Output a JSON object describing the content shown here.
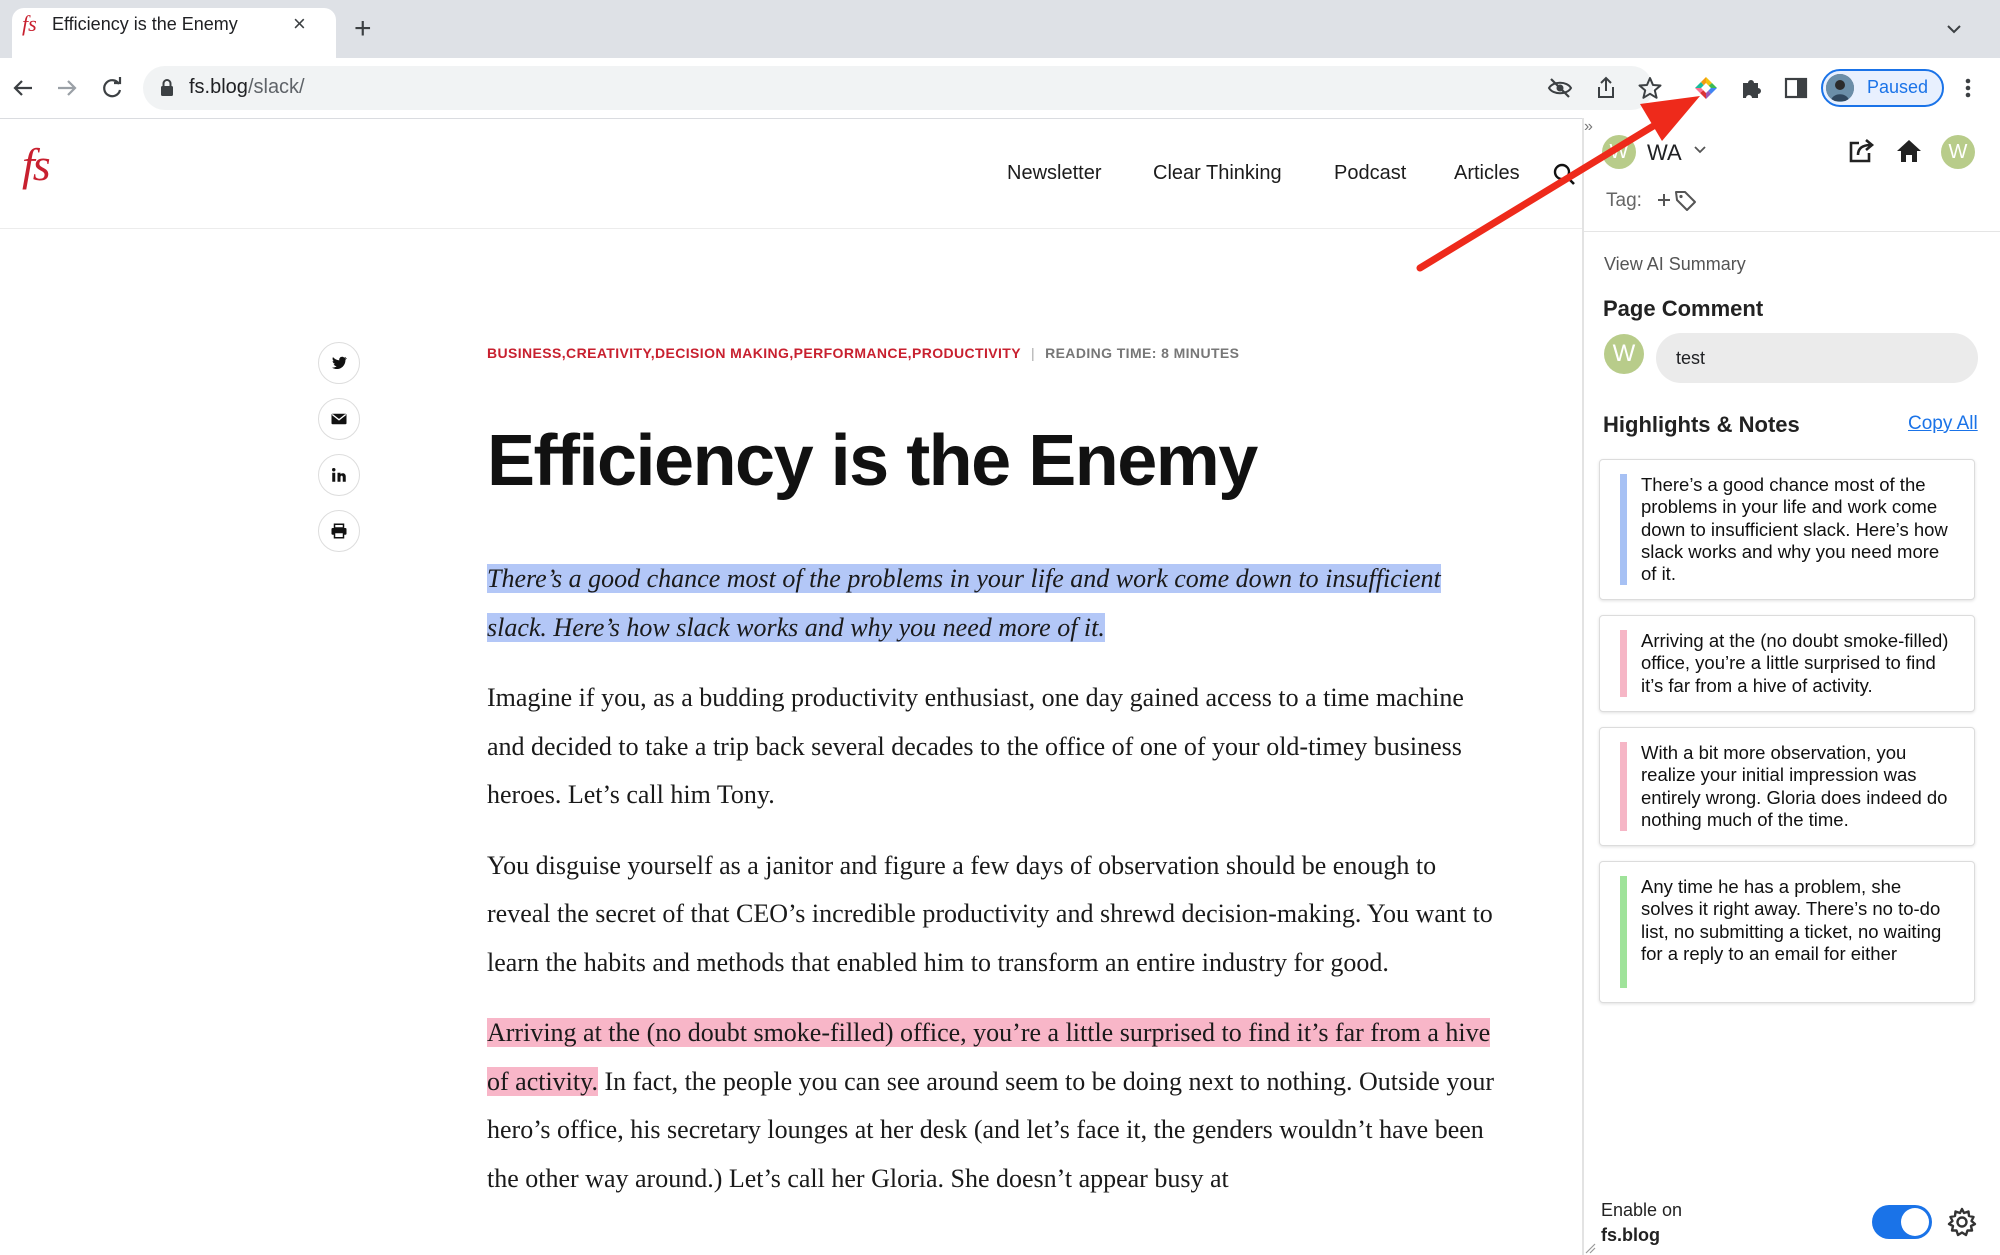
{
  "browser": {
    "tab": {
      "favicon": "fs",
      "title": "Efficiency is the Enemy",
      "close": "×"
    },
    "new_tab": "+",
    "url": {
      "host": "fs.blog",
      "path": "/slack/"
    },
    "profile": {
      "label": "Paused"
    },
    "icons": [
      "back-icon",
      "forward-icon",
      "reload-icon",
      "lock-icon",
      "eye-off-icon",
      "share-icon",
      "star-icon",
      "extension-colorful-icon",
      "puzzle-icon",
      "side-panel-icon",
      "kebab-menu-icon"
    ]
  },
  "site": {
    "logo": "fs",
    "nav": [
      "Newsletter",
      "Clear Thinking",
      "Podcast",
      "Articles"
    ],
    "categories": "BUSINESS,CREATIVITY,DECISION MAKING,PERFORMANCE,PRODUCTIVITY",
    "category_sep": "|",
    "reading_time": "READING TIME: 8 MINUTES",
    "title": "Efficiency is the Enemy",
    "article": {
      "p1_hl": "There’s a good chance most of the problems in your life and work come down to insufficient slack. Here’s how slack works and why you need more of it.",
      "p2": "Imagine if you, as a budding productivity enthusiast, one day gained access to a time machine and decided to take a trip back several decades to the office of one of your old-timey business heroes. Let’s call him Tony.",
      "p3": "You disguise yourself as a janitor and figure a few days of observation should be enough to reveal the secret of that CEO’s incredible productivity and shrewd decision-making. You want to learn the habits and methods that enabled him to transform an entire industry for good.",
      "p4_hl": "Arriving at the (no doubt smoke-filled) office, you’re a little surprised to find it’s far from a hive of activity.",
      "p4_rest": " In fact, the people you can see around seem to be doing next to nothing. Outside your hero’s office, his secretary lounges at her desk (and let’s face it, the genders wouldn’t have been the other way around.) Let’s call her Gloria. She doesn’t appear busy at"
    }
  },
  "sidebar": {
    "collapse": "»",
    "user_initial": "W",
    "workspace": "WA",
    "tag_label": "Tag:",
    "tag_add": "+",
    "view_ai_summary": "View AI Summary",
    "page_comment_heading": "Page Comment",
    "comment": {
      "avatar": "W",
      "text": "test"
    },
    "highlights_heading": "Highlights & Notes",
    "copy_all": "Copy All",
    "highlights": [
      {
        "text": "There’s a good chance most of the problems in your life and work come down to insufficient slack. Here’s how slack works and why you need more of it.",
        "color": "#a7c1f4"
      },
      {
        "text": "Arriving at the (no doubt smoke-filled) office, you’re a little surprised to find it’s far from a hive of activity.",
        "color": "#f6b6c6"
      },
      {
        "text": "With a bit more observation, you realize your initial impression was entirely wrong. Gloria does indeed do nothing much of the time.",
        "color": "#f6b6c6"
      },
      {
        "text": "Any time he has a problem, she solves it right away. There’s no to-do list, no submitting a ticket, no waiting for a reply to an email for either",
        "color": "#9fe39a"
      }
    ],
    "enable_label": "Enable on",
    "enable_site": "fs.blog",
    "toggle_on": true
  },
  "colors": {
    "accent": "#1a73e8",
    "brand_red": "#c8202f",
    "arrow": "#ee2a1b",
    "highlight_blue": "#b3c7f7",
    "highlight_pink": "#f8b6c8"
  }
}
